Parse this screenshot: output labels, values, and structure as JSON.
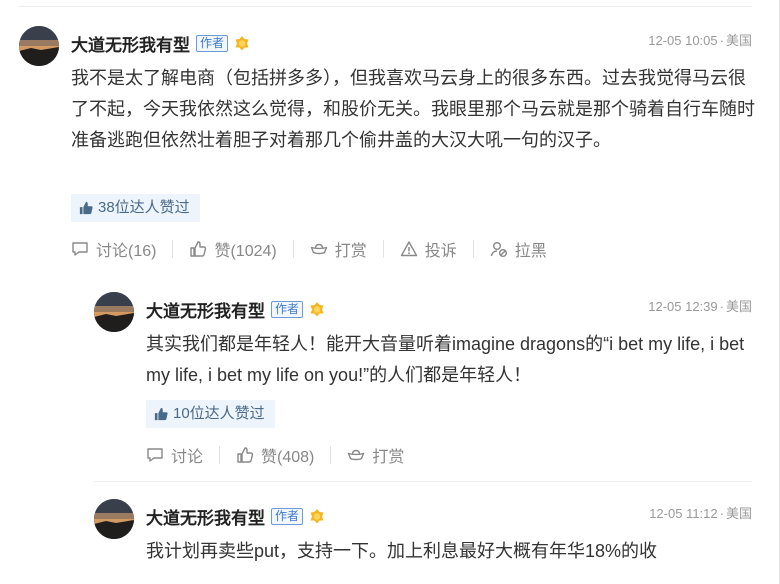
{
  "comments": [
    {
      "author": "大道无形我有型",
      "tag": "作者",
      "time": "12-05 10:05",
      "location": "美国",
      "text": "我不是太了解电商（包括拼多多），但我喜欢马云身上的很多东西。过去我觉得马云很了不起，今天我依然这么觉得，和股价无关。我眼里那个马云就是那个骑着自行车随时准备逃跑但依然壮着胆子对着那几个偷井盖的大汉大吼一句的汉子。",
      "likes": "38位达人赞过",
      "actions": {
        "discuss": "讨论(16)",
        "like": "赞(1024)",
        "tip": "打赏",
        "report": "投诉",
        "block": "拉黑"
      }
    },
    {
      "author": "大道无形我有型",
      "tag": "作者",
      "time": "12-05 12:39",
      "location": "美国",
      "text": "其实我们都是年轻人！能开大音量听着imagine dragons的“i bet my life, i bet my life, i bet my life on you!”的人们都是年轻人！",
      "likes": "10位达人赞过",
      "actions": {
        "discuss": "讨论",
        "like": "赞(408)",
        "tip": "打赏"
      }
    },
    {
      "author": "大道无形我有型",
      "tag": "作者",
      "time": "12-05 11:12",
      "location": "美国",
      "text": "我计划再卖些put，支持一下。加上利息最好大概有年华18%的收"
    }
  ],
  "separator": "·"
}
